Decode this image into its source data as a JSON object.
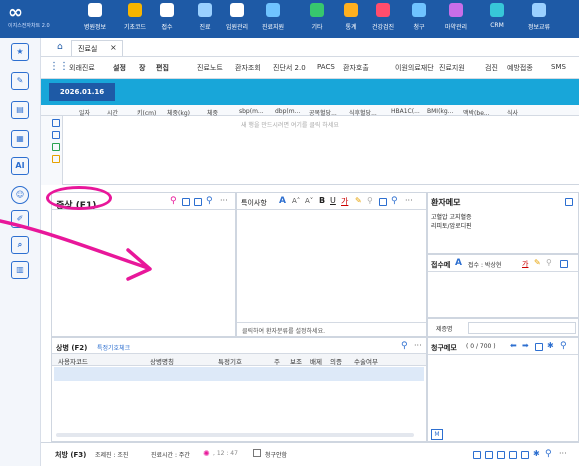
{
  "app": {
    "logo_text": "이지스전자차트 2.0"
  },
  "toolbar": {
    "items": [
      {
        "label": "병원정보",
        "color": "#ffffff"
      },
      {
        "label": "기초코드",
        "color": "#f7b500"
      },
      {
        "label": "접수",
        "color": "#ffffff"
      },
      {
        "label": "진료",
        "color": "#9ad0ff"
      },
      {
        "label": "입원관리",
        "color": "#ffffff"
      },
      {
        "label": "진료지원",
        "color": "#6fc3ff"
      },
      {
        "label": "기타",
        "color": "#37c86e"
      },
      {
        "label": "통계",
        "color": "#ffb020"
      },
      {
        "label": "건강검진",
        "color": "#ff4d6d"
      },
      {
        "label": "청구",
        "color": "#6fc3ff"
      },
      {
        "label": "마약관리",
        "color": "#c86ee8"
      },
      {
        "label": "CRM",
        "color": "#37c8d8"
      },
      {
        "label": "정보교류",
        "color": "#9ad0ff"
      }
    ]
  },
  "tabs": {
    "home_icon": "home-icon",
    "active_tab": "진료실",
    "close": "×"
  },
  "menu": {
    "grid_icon": "grid-icon",
    "items": [
      "외래진료",
      "설정",
      "장",
      "편집",
      "진료노트",
      "환자조회",
      "진단서 2.0",
      "PACS",
      "환자호출",
      "이원의료재단",
      "진료지원",
      "검진",
      "예방접종",
      "SMS"
    ]
  },
  "date": {
    "value": "2026.01.16"
  },
  "vitals": {
    "headers": [
      "일자",
      "시간",
      "키(cm)",
      "체중(kg)",
      "체중",
      "sbp(m...",
      "dbp(m...",
      "공복혈당...",
      "식후혈당...",
      "HBA1C(...",
      "BMI(kg...",
      "맥박(be...",
      "식사"
    ],
    "placeholder": "새 행을 만드시려면 여기를 클릭 하세요"
  },
  "symptom": {
    "title": "증상 (F1)"
  },
  "special": {
    "title": "특이사항",
    "footer": "클릭하여 환자분류를 설정하세요."
  },
  "patient_memo": {
    "title": "환자메모",
    "lines": [
      "고혈압 고지혈증",
      "리피토/암로디핀"
    ]
  },
  "reception_memo": {
    "title": "접수메",
    "receiver": "접수 : 박상현",
    "font_label": "가"
  },
  "cert": {
    "label": "제증명"
  },
  "disease": {
    "title": "상병 (F2)",
    "link": "특정기호체크",
    "headers": [
      "사용자코드",
      "",
      "상병명칭",
      "특정기호",
      "주",
      "보조",
      "배제",
      "의증",
      "수술여부"
    ]
  },
  "claim_memo": {
    "title": "청구메모",
    "count": "( 0 / 700 )",
    "m_label": "M"
  },
  "rx": {
    "title": "처방 (F3)",
    "prep_label": "조제진 : 조진",
    "time_label": "진료시간 : 주간",
    "time_value": ", 12 : 47",
    "claim_check": "청구안함"
  }
}
